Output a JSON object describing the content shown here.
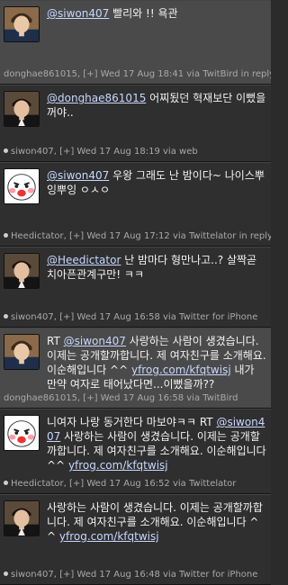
{
  "tweets": [
    {
      "user": "@siwon407",
      "body": " 빨리와 !! 욕관",
      "meta": "donghae861015, [+] Wed 17 Aug 18:41 via TwitBird in reply t",
      "avatar": "donghae-avatar"
    },
    {
      "user": "@donghae861015",
      "body": " 어찌됬던 혁재보단 이뻤을꺼야..",
      "meta": "siwon407, [+] Wed 17 Aug 18:19 via web",
      "avatar": "siwon-avatar"
    },
    {
      "user": "@siwon407",
      "body": " 우왕 그래도 난 밤이다~ 나이스뿌잉뿌잉 ㅇㅅㅇ",
      "meta": "Heedictator, [+] Wed 17 Aug 17:12 via Twittelator in reply to",
      "avatar": "heedictator-avatar"
    },
    {
      "user": "@Heedictator",
      "body": " 난 밤마다 형만나고..? 살짝곧치아픈관계구만! ㅋㅋ",
      "meta": "siwon407, [+] Wed 17 Aug 16:58 via Twitter for iPhone",
      "avatar": "siwon-avatar"
    },
    {
      "prefix": "RT ",
      "user": "@siwon407",
      "body": " 사랑하는 사람이 생겼습니다. 이제는 공개할까합니다. 제 여자친구를 소개해요. 이순해입니다 ^^ ",
      "link": "yfrog.com/kfqtwisj",
      "suffix": " 내가 만약 여자로 태어났다면...이뻤을까??",
      "meta": "donghae861015, [+] Wed 17 Aug 16:58 via TwitBird",
      "avatar": "donghae-avatar"
    },
    {
      "prefix": "니여자 나랑 동거한다 마보야ㅋㅋ RT ",
      "user": "@siwon407",
      "body": " 사랑하는 사람이 생겼습니다. 이제는 공개할까합니다. 제 여자친구를 소개해요. 이순해입니다 ^^ ",
      "link": "yfrog.com/kfqtwisj",
      "meta": "Heedictator, [+] Wed 17 Aug 16:52 via Twittelator",
      "avatar": "heedictator-avatar"
    },
    {
      "body": "사랑하는 사람이 생겼습니다. 이제는 공개할까합니다. 제 여자친구를 소개해요. 이순해입니다 ^^ ",
      "link": "yfrog.com/kfqtwisj",
      "meta": "siwon407, [+] Wed 17 Aug 16:48 via Twitter for iPhone",
      "avatar": "siwon-avatar"
    }
  ]
}
